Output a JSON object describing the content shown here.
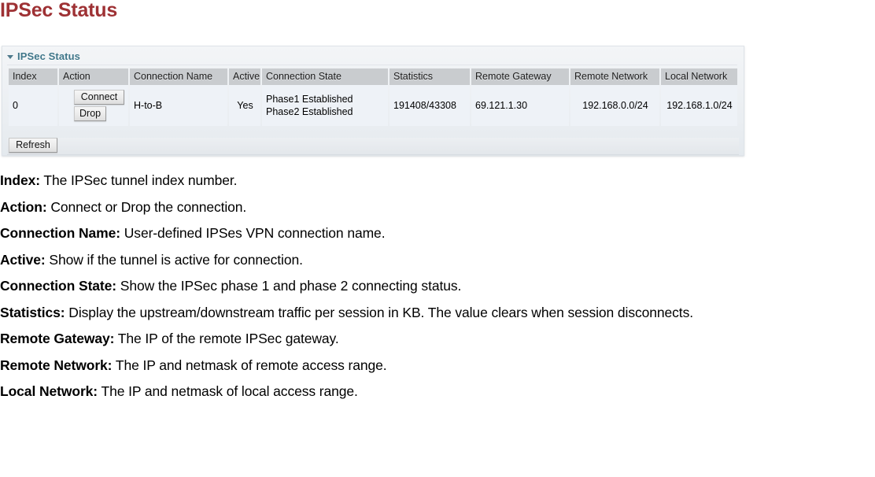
{
  "page": {
    "title": "IPSec Status",
    "title_color": "#9e3134"
  },
  "panel": {
    "title": "IPSec Status",
    "collapse_icon": "triangle-down-icon",
    "title_color": "#3f7689"
  },
  "table": {
    "columns": [
      "Index",
      "Action",
      "Connection Name",
      "Active",
      "Connection State",
      "Statistics",
      "Remote Gateway",
      "Remote Network",
      "Local Network"
    ],
    "rows": [
      {
        "index": "0",
        "action": {
          "connect_label": "Connect",
          "drop_label": "Drop"
        },
        "connection_name": "H-to-B",
        "active": "Yes",
        "connection_state_line1": "Phase1 Established",
        "connection_state_line2": "Phase2 Established",
        "statistics": "191408/43308",
        "remote_gateway": "69.121.1.30",
        "remote_network": "192.168.0.0/24",
        "local_network": "192.168.1.0/24"
      }
    ],
    "refresh_label": "Refresh"
  },
  "descriptions": [
    {
      "term": "Index:",
      "text": " The IPSec tunnel index number."
    },
    {
      "term": "Action:",
      "text": " Connect or Drop the connection."
    },
    {
      "term": "Connection Name:",
      "text": " User-defined IPSes VPN connection name."
    },
    {
      "term": "Active:",
      "text": " Show if the tunnel is active for connection."
    },
    {
      "term": "Connection State:",
      "text": " Show the IPSec phase 1 and phase 2 connecting status."
    },
    {
      "term": "Statistics:",
      "text": " Display the upstream/downstream traffic per session in KB. The value clears when session disconnects."
    },
    {
      "term": "Remote Gateway:",
      "text": " The IP of the remote IPSec gateway."
    },
    {
      "term": "Remote Network:",
      "text": " The IP and netmask of remote access range."
    },
    {
      "term": "Local Network:",
      "text": " The IP and netmask of local access range."
    }
  ]
}
